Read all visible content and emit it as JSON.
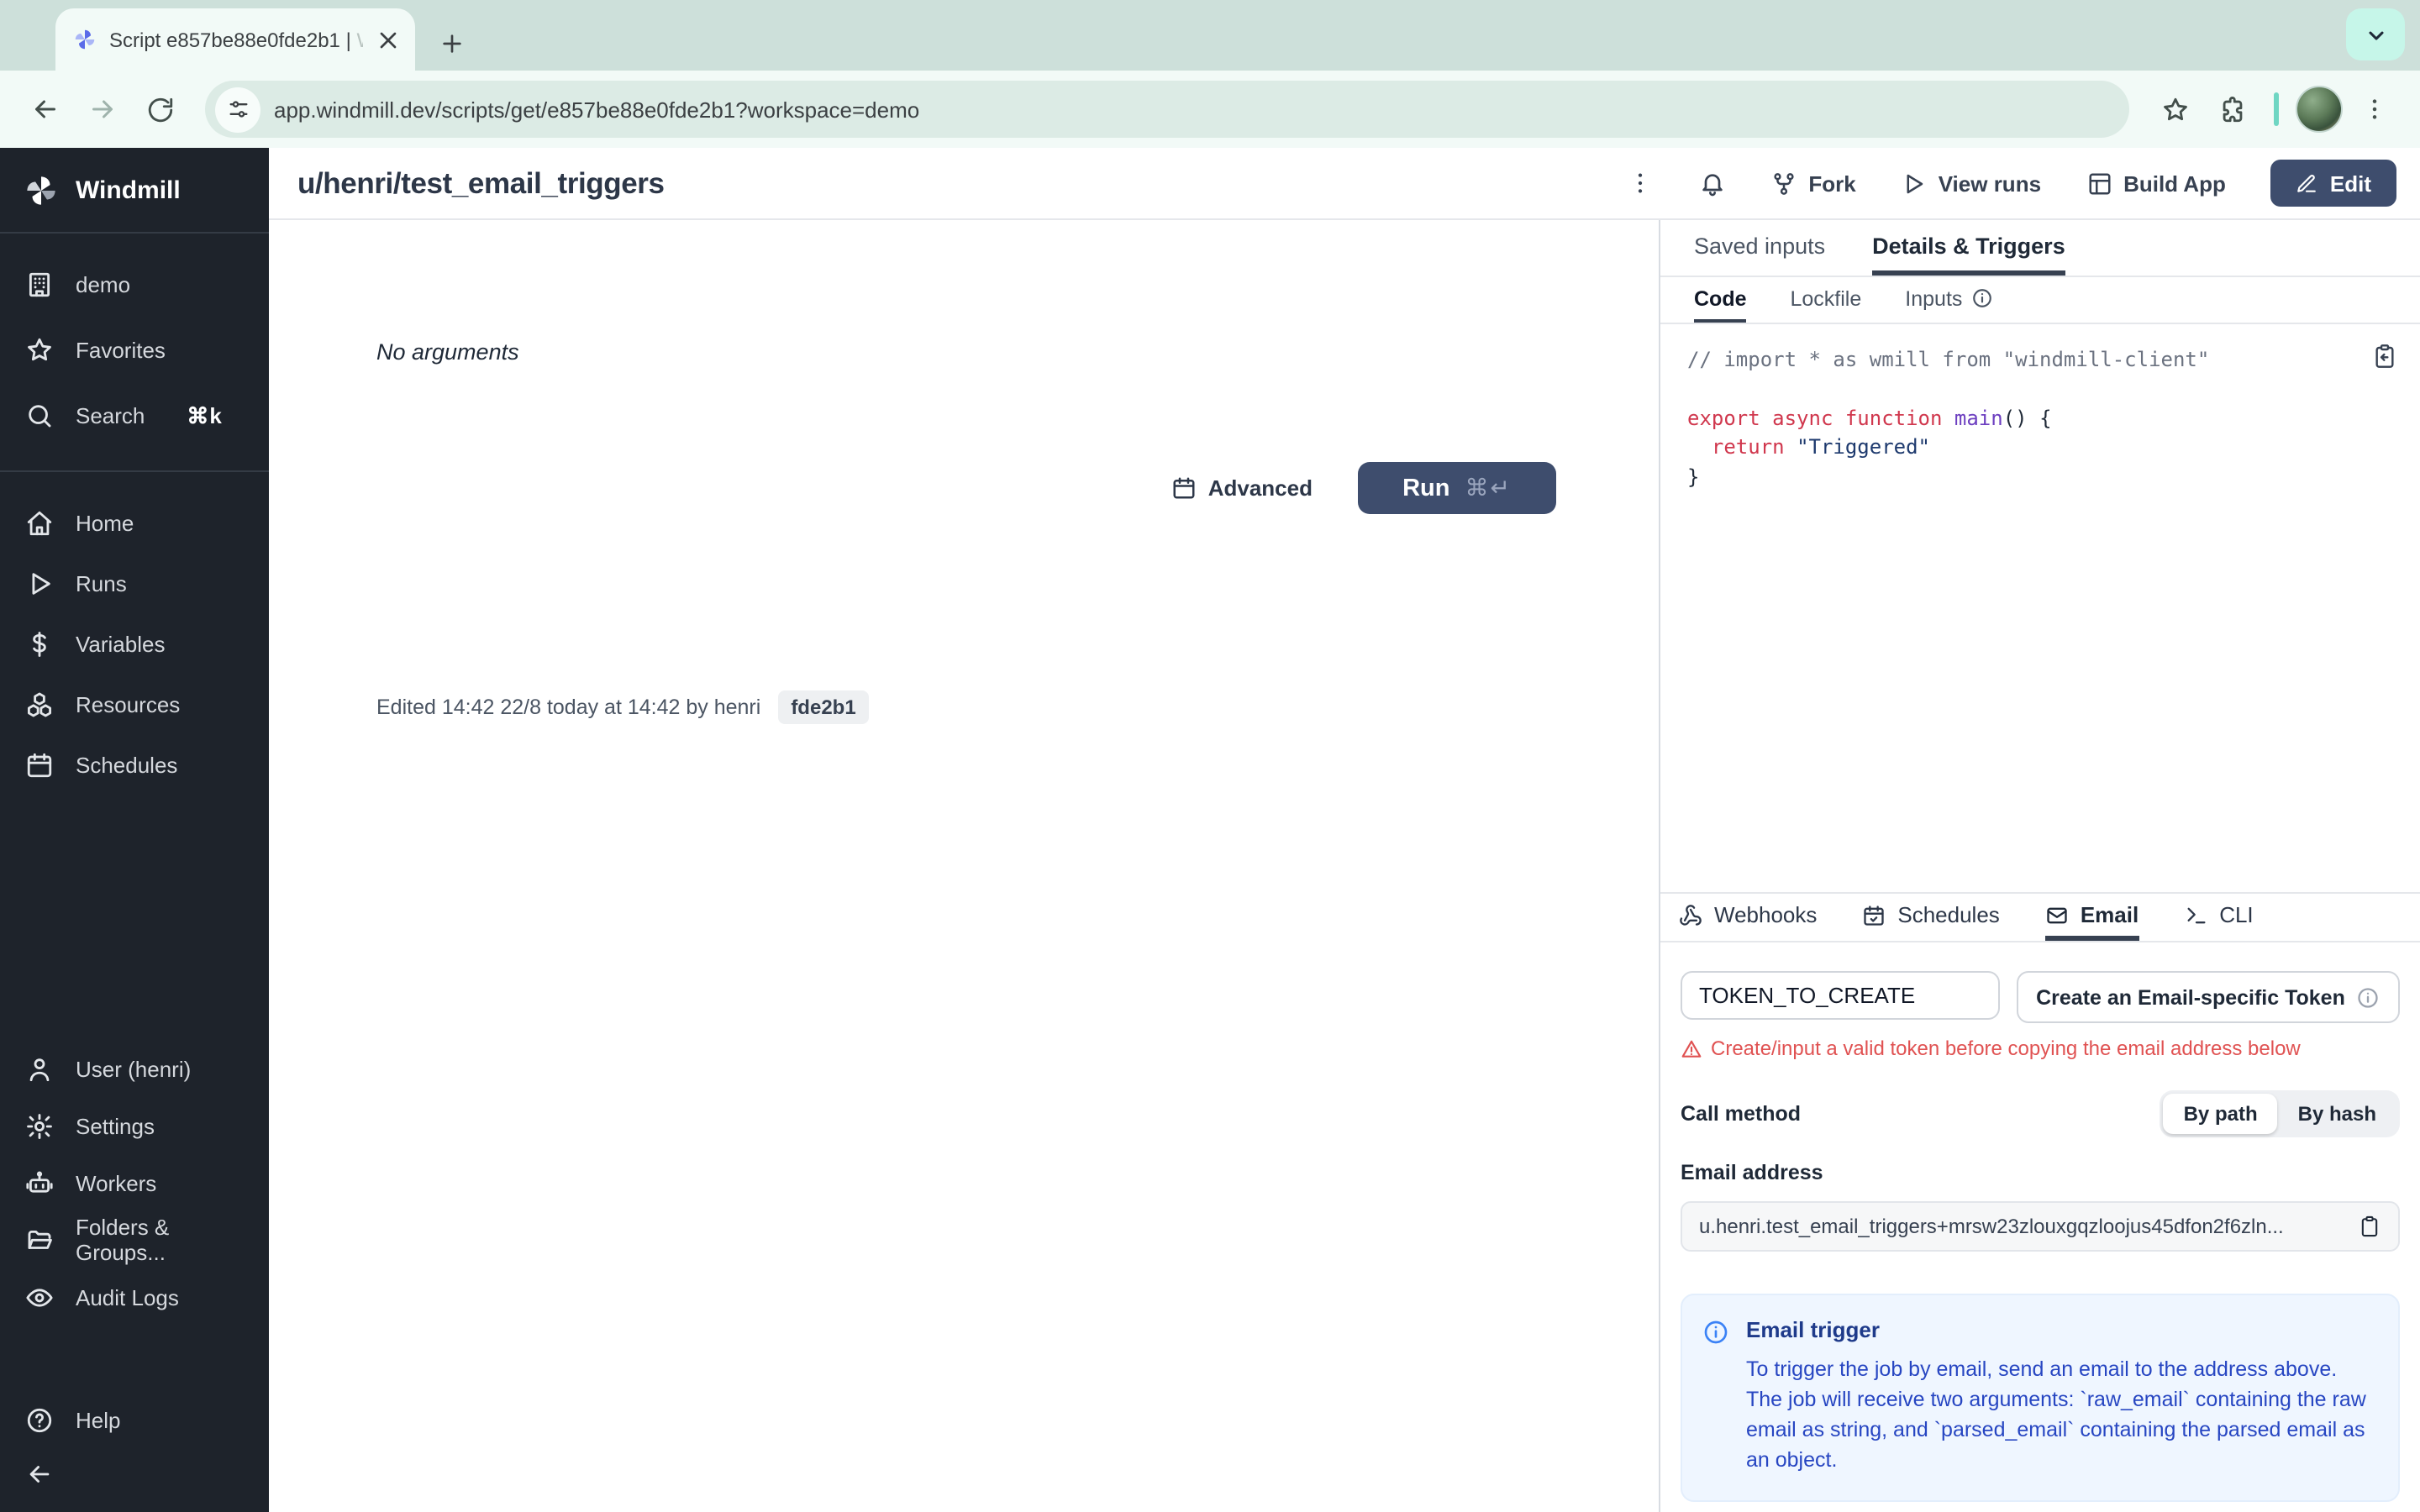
{
  "browser": {
    "tab_title": "Script e857be88e0fde2b1 | ",
    "tab_title_fade": "W",
    "url": "app.windmill.dev/scripts/get/e857be88e0fde2b1?workspace=demo"
  },
  "sidebar": {
    "logo_label": "Windmill",
    "workspace": "demo",
    "favorites": "Favorites",
    "search": "Search",
    "search_shortcut": "⌘k",
    "home": "Home",
    "runs": "Runs",
    "variables": "Variables",
    "resources": "Resources",
    "schedules": "Schedules",
    "user": "User (henri)",
    "settings": "Settings",
    "workers": "Workers",
    "folders": "Folders & Groups...",
    "audit": "Audit Logs",
    "help": "Help"
  },
  "header": {
    "title": "u/henri/test_email_triggers",
    "fork": "Fork",
    "view_runs": "View runs",
    "build_app": "Build App",
    "edit": "Edit"
  },
  "left": {
    "no_args": "No arguments",
    "advanced": "Advanced",
    "run": "Run",
    "run_shortcut": "⌘↵",
    "edited": "Edited 14:42 22/8 today at 14:42 by henri",
    "hash": "fde2b1"
  },
  "panel": {
    "tab_saved": "Saved inputs",
    "tab_details": "Details & Triggers",
    "sub_code": "Code",
    "sub_lockfile": "Lockfile",
    "sub_inputs": "Inputs",
    "code": {
      "l1": "// import * as wmill from \"windmill-client\"",
      "l3_kw": "export async function ",
      "l3_fn": "main",
      "l3_rest": "() {",
      "l4_kw": "return ",
      "l4_str": "\"Triggered\"",
      "l5": "}"
    },
    "triggers": {
      "webhooks": "Webhooks",
      "schedules": "Schedules",
      "email": "Email",
      "cli": "CLI"
    },
    "email": {
      "token_value": "TOKEN_TO_CREATE",
      "create_btn": "Create an Email-specific Token",
      "warning": "Create/input a valid token before copying the email address below",
      "call_method": "Call method",
      "by_path": "By path",
      "by_hash": "By hash",
      "email_label": "Email address",
      "address": "u.henri.test_email_triggers+mrsw23zlouxgqzloojus45dfon2f6zln...",
      "info_title": "Email trigger",
      "info_body": "To trigger the job by email, send an email to the address above. The job will receive two arguments: `raw_email` containing the raw email as string, and `parsed_email` containing the parsed email as an object."
    }
  },
  "colors": {
    "accent_button": "#3e4d6d",
    "sidebar_bg": "#1e232b",
    "warning_red": "#e05252",
    "info_blue_bg": "#eff6ff",
    "chrome_mint": "#cde0da"
  }
}
